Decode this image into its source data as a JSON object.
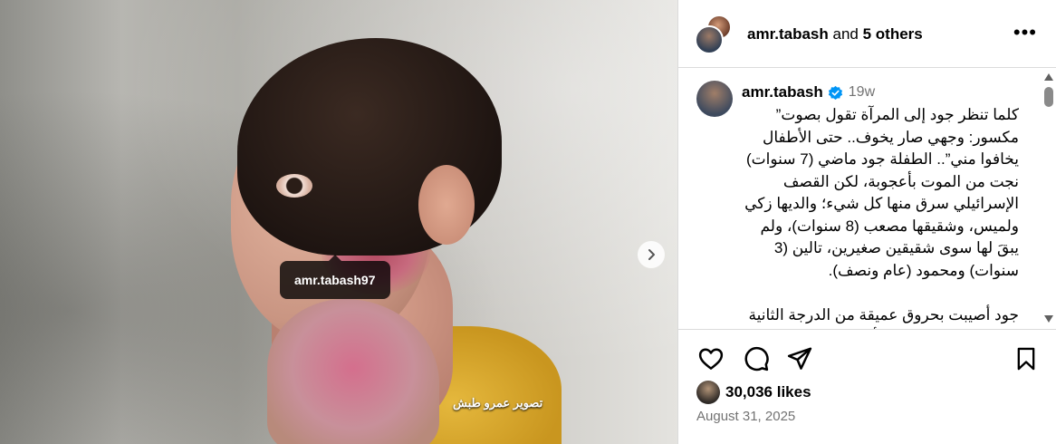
{
  "media": {
    "tag_username": "amr.tabash97",
    "photo_credit": "تصوير عمرو طبش",
    "next_icon": "chevron-right-icon"
  },
  "header": {
    "author": "amr.tabash",
    "and_text": "and",
    "others": "5 others",
    "more_icon": "more-horizontal-icon",
    "more_label": "•••"
  },
  "caption": {
    "username": "amr.tabash",
    "verified_icon": "verified-badge-icon",
    "verified_color": "#0095f6",
    "time_ago": "19w",
    "text": "كلما تنظر جود إلى المرآة تقول بصوت” مكسور: وجهي صار يخوف.. حتى الأطفال يخافوا مني”.. الطفلة جود ماضي (7 سنوات) نجت من الموت بأعجوبة، لكن القصف الإسرائيلي سرق منها كل شيء؛ والديها زكي ولميس، وشقيقها مصعب (8 سنوات)، ولم يبقَ لها سوى شقيقين صغيرين، تالين (3 سنوات) ومحمود (عام ونصف).\n\nجود أصيبت بحروق عميقة من الدرجة الثانية شوهت وجهها وكتفها الأيسر وقدميها، فغيرت"
  },
  "actions": {
    "like_icon": "heart-icon",
    "comment_icon": "comment-icon",
    "share_icon": "send-icon",
    "save_icon": "bookmark-icon"
  },
  "likes": {
    "count_text": "30,036 likes"
  },
  "date": "August 31, 2025"
}
